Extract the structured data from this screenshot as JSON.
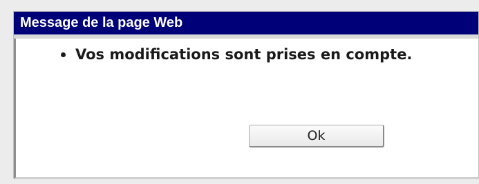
{
  "dialog": {
    "title": "Message de la page Web",
    "messages": [
      "Vos modifications sont prises en compte."
    ],
    "ok_label": "Ok"
  },
  "colors": {
    "title_bar": "#000078",
    "title_text": "#ffffff",
    "background": "#ececec"
  }
}
